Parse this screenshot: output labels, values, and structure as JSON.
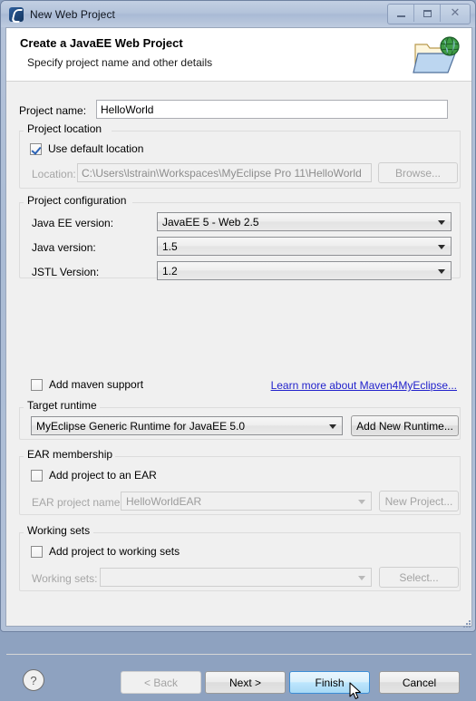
{
  "window": {
    "title": "New Web Project",
    "icon": "myeclipse-icon",
    "buttons": {
      "minimize": "minimize-button",
      "maximize": "maximize-button",
      "close": "close-button"
    }
  },
  "banner": {
    "title": "Create a JavaEE Web Project",
    "subtitle": "Specify project name and other details",
    "icon": "web-project-folder-globe-icon"
  },
  "project_name": {
    "label": "Project name:",
    "value": "HelloWorld"
  },
  "project_location": {
    "group_title": "Project location",
    "use_default_label": "Use default location",
    "use_default_checked": true,
    "location_label": "Location:",
    "location_value": "C:\\Users\\lstrain\\Workspaces\\MyEclipse Pro 11\\HelloWorld",
    "browse_label": "Browse..."
  },
  "project_configuration": {
    "group_title": "Project configuration",
    "javaee_label": "Java EE version:",
    "javaee_value": "JavaEE 5 - Web 2.5",
    "java_label": "Java version:",
    "java_value": "1.5",
    "jstl_label": "JSTL Version:",
    "jstl_value": "1.2",
    "maven_label": "Add maven support",
    "maven_checked": false,
    "maven_link": "Learn more about Maven4MyEclipse..."
  },
  "target_runtime": {
    "group_title": "Target runtime",
    "value": "MyEclipse Generic Runtime for JavaEE 5.0",
    "add_button": "Add New Runtime..."
  },
  "ear_membership": {
    "group_title": "EAR membership",
    "add_to_ear_label": "Add project to an EAR",
    "add_to_ear_checked": false,
    "ear_name_label": "EAR project name:",
    "ear_name_value": "HelloWorldEAR",
    "new_project_label": "New Project..."
  },
  "working_sets": {
    "group_title": "Working sets",
    "add_label": "Add project to working sets",
    "add_checked": false,
    "sets_label": "Working sets:",
    "sets_value": "",
    "select_label": "Select..."
  },
  "footer": {
    "help": "?",
    "back": "< Back",
    "next": "Next >",
    "finish": "Finish",
    "cancel": "Cancel"
  },
  "colors": {
    "accent": "#2a62b6",
    "link": "#2222cc",
    "dialog_bg": "#f0f0f0",
    "banner_bg": "#ffffff",
    "finish_hover": "#bee6fd"
  }
}
